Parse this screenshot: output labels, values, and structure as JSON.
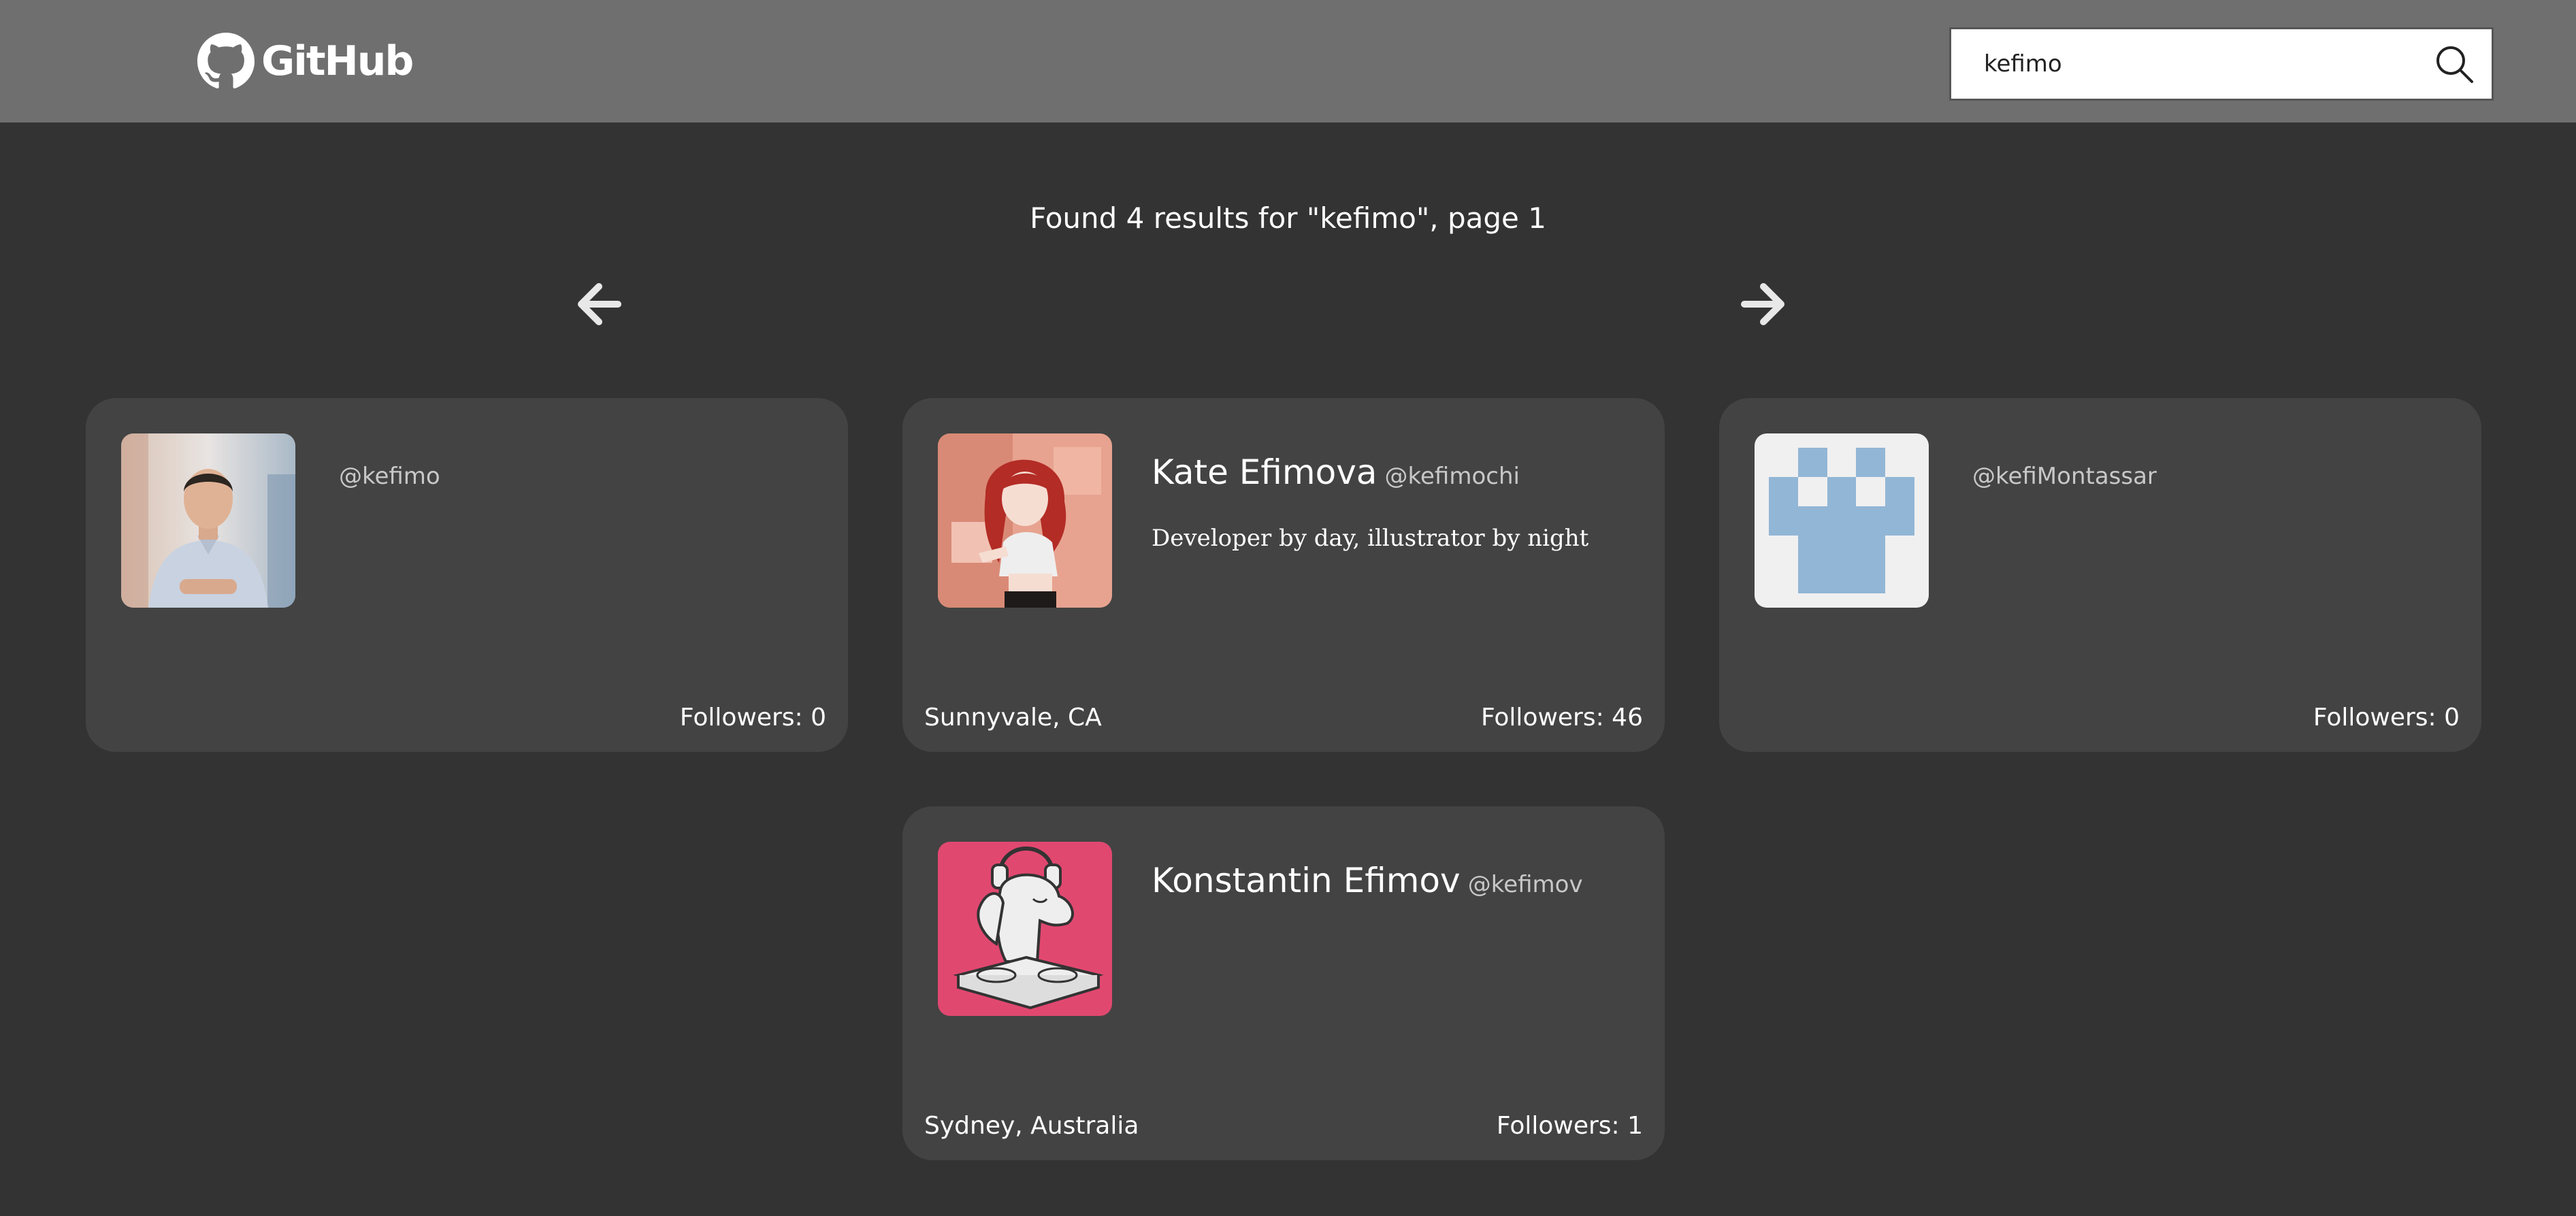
{
  "header": {
    "brand": "GitHub",
    "search_value": "kefimo",
    "search_placeholder": ""
  },
  "results": {
    "summary": "Found 4 results for \"kefimo\", page 1",
    "prev_icon": "arrow-left-icon",
    "next_icon": "arrow-right-icon"
  },
  "users": [
    {
      "name": "",
      "handle": "@kefimo",
      "bio": "",
      "location": "",
      "followers": "Followers: 0",
      "avatar": "photo-avatar"
    },
    {
      "name": "Kate Efimova",
      "handle": "@kefimochi",
      "bio": "Developer by day, illustrator by night",
      "location": "Sunnyvale, CA",
      "followers": "Followers: 46",
      "avatar": "illustration-avatar"
    },
    {
      "name": "",
      "handle": "@kefiMontassar",
      "bio": "",
      "location": "",
      "followers": "Followers: 0",
      "avatar": "identicon-avatar"
    },
    {
      "name": "Konstantin Efimov",
      "handle": "@kefimov",
      "bio": "",
      "location": "Sydney, Australia",
      "followers": "Followers: 1",
      "avatar": "dj-dog-avatar"
    }
  ],
  "colors": {
    "topbar": "#6f6f6f",
    "page_bg": "#333333",
    "card_bg": "#434343",
    "identicon": "#92b6d5",
    "dj_avatar_bg": "#e14870"
  }
}
